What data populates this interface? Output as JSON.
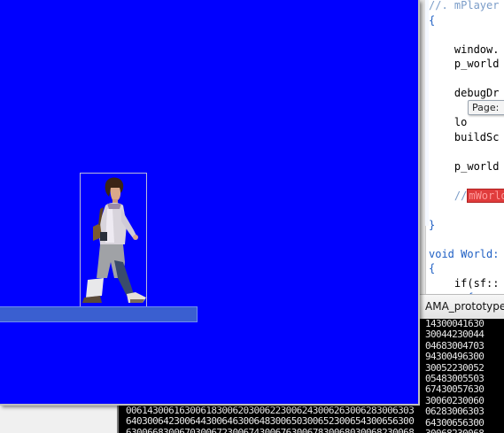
{
  "game_window": {
    "background_color": "#0000ff",
    "platform_color": "#3a5fd0",
    "character": "walking-character-sprite"
  },
  "editor": {
    "lines": [
      {
        "text": "//. mPlayer",
        "style": "comment"
      },
      {
        "text": "{",
        "style": "brace"
      },
      {
        "text": "",
        "style": "normal"
      },
      {
        "text": "    window.",
        "style": "normal"
      },
      {
        "text": "    p_world",
        "style": "normal"
      },
      {
        "text": "",
        "style": "normal"
      },
      {
        "text": "    debugDr",
        "style": "normal"
      },
      {
        "text": "",
        "style": "normal"
      },
      {
        "text": "    lo",
        "style": "normal"
      },
      {
        "text": "    buildSc",
        "style": "normal"
      },
      {
        "text": "",
        "style": "normal"
      },
      {
        "text": "    p_world",
        "style": "normal"
      },
      {
        "text": "",
        "style": "normal"
      },
      {
        "text": "    //",
        "style": "comment",
        "highlight": "mWorld"
      },
      {
        "text": "",
        "style": "normal"
      },
      {
        "text": "}",
        "style": "brace"
      },
      {
        "text": "",
        "style": "normal"
      },
      {
        "text": "void World:",
        "style": "kw"
      },
      {
        "text": "{",
        "style": "brace"
      },
      {
        "text": "    if(sf::",
        "style": "normal"
      },
      {
        "text": "      {",
        "style": "brace"
      }
    ],
    "tooltip": "Page:"
  },
  "console": {
    "title": "AMA_prototype.e",
    "lines": [
      "14300041630",
      "30044230044",
      "04683004703",
      "94300496300",
      "30052230052",
      "05483005503",
      "67430057630",
      "30060230060",
      "06283006303",
      "64300656300",
      "30068230068"
    ],
    "bottom_lines": [
      "006143006163006183006203006223006243006263006283006303",
      "640300642300644300646300648300650300652300654300656300",
      "630066830067030067230067430067630067830068030068230068"
    ]
  }
}
